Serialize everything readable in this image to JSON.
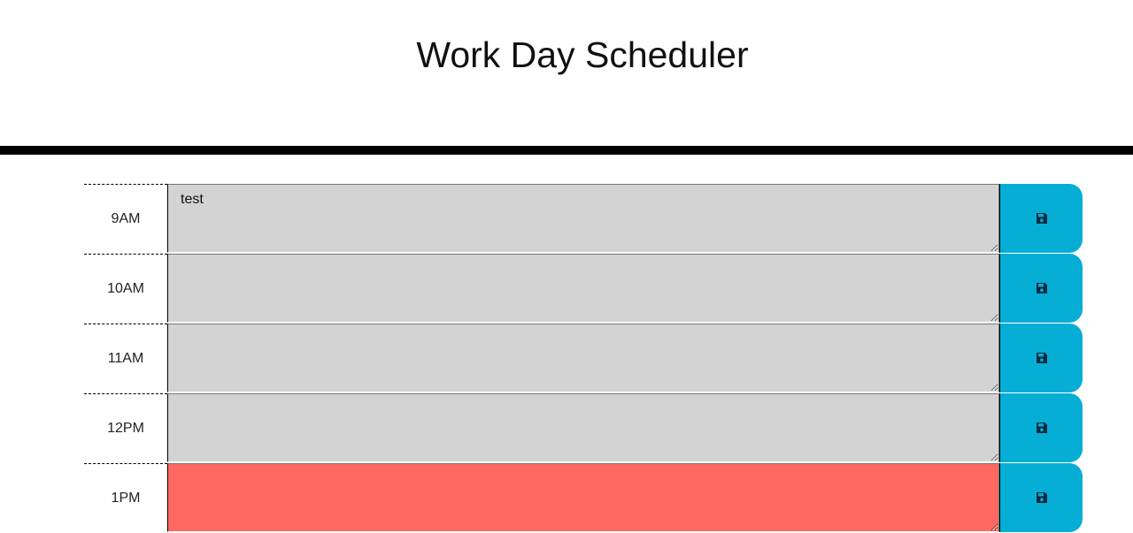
{
  "header": {
    "title": "Work Day Scheduler"
  },
  "colors": {
    "past": "#d3d3d3",
    "present": "#ff6961",
    "save_button": "#06aed5"
  },
  "time_blocks": [
    {
      "hour": "9AM",
      "text": "test",
      "state": "past",
      "save_icon": "floppy-disk-icon"
    },
    {
      "hour": "10AM",
      "text": "",
      "state": "past",
      "save_icon": "floppy-disk-icon"
    },
    {
      "hour": "11AM",
      "text": "",
      "state": "past",
      "save_icon": "floppy-disk-icon"
    },
    {
      "hour": "12PM",
      "text": "",
      "state": "past",
      "save_icon": "floppy-disk-icon"
    },
    {
      "hour": "1PM",
      "text": "",
      "state": "present",
      "save_icon": "floppy-disk-icon"
    }
  ]
}
